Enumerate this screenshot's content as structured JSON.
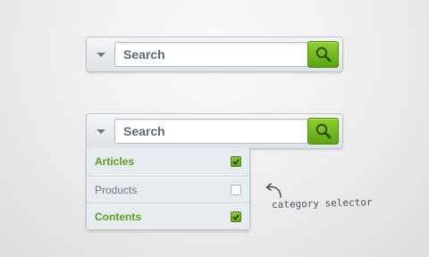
{
  "search_bars": [
    {
      "placeholder": "Search",
      "expanded": false
    },
    {
      "placeholder": "Search",
      "expanded": true
    }
  ],
  "category_dropdown": {
    "items": [
      {
        "label": "Articles",
        "checked": true
      },
      {
        "label": "Products",
        "checked": false
      },
      {
        "label": "Contents",
        "checked": true
      }
    ]
  },
  "annotation": {
    "text": "category selector"
  },
  "icons": {
    "search": "magnifier-icon",
    "toggle": "caret-down-icon",
    "checkbox": "check-icon",
    "annotation": "curved-arrow-icon"
  },
  "colors": {
    "accent": "#6cb31a",
    "checked_text": "#58a116",
    "unchecked_text": "#6d7882",
    "placeholder": "#5d6b78"
  }
}
